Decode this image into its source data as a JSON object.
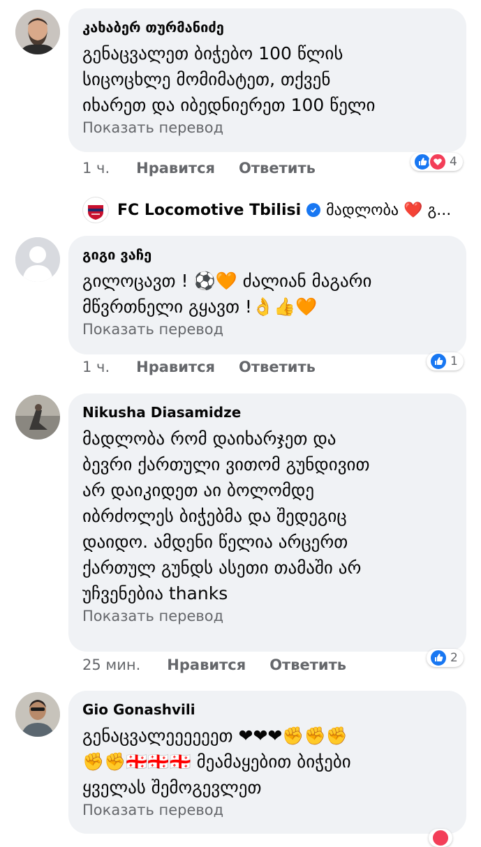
{
  "comments": [
    {
      "author": "კახაბერ თურმანიძე",
      "lines": [
        "გენაცვალეთ ბიჭებო 100 წლის",
        "სიცოცხლე მომიმატეთ, თქვენ",
        "იხარეთ და იბედნიერეთ 100 წელი"
      ],
      "translate": "Показать перевод",
      "time": "1 ч.",
      "like": "Нравится",
      "reply": "Ответить",
      "reaction_count": "4",
      "reactions": [
        "like-icon",
        "love-icon"
      ]
    },
    {
      "author": "გიგი ვაჩე",
      "lines": [
        "გილოცავთ ! ⚽🧡 ძალიან მაგარი",
        "მწვრთნელი გყავთ !👌👍🧡"
      ],
      "translate": "Показать перевод",
      "time": "1 ч.",
      "like": "Нравится",
      "reply": "Ответить",
      "reaction_count": "1",
      "reactions": [
        "like-icon"
      ]
    },
    {
      "author": "Nikusha Diasamidze",
      "lines": [
        "მადლობა რომ დაიხარჯეთ და",
        "ბევრი ქართული ვითომ გუნდივით",
        "არ დაიკიდეთ აი ბოლომდე",
        "იბრძოლეს ბიჭებმა და შედეგიც",
        "დაიდო. ამდენი წელია არცერთ",
        "ქართულ გუნდს ასეთი თამაში არ",
        "უჩვენებია thanks"
      ],
      "translate": "Показать перевод",
      "time": "25 мин.",
      "like": "Нравится",
      "reply": "Ответить",
      "reaction_count": "2",
      "reactions": [
        "like-icon"
      ]
    },
    {
      "author": "Gio Gonashvili",
      "lines": [
        "გენაცვალეეეეეეთ ❤❤❤✊✊✊",
        "✊✊🇬🇪🇬🇪🇬🇪 მეამაყებით ბიჭები",
        "ყველას შემოგევლეთ"
      ],
      "translate": "Показать перевод"
    }
  ],
  "page_reply": {
    "name": "FC Locomotive Tbilisi",
    "text": "მადლობა ❤️ გ..."
  },
  "colors": {
    "bubble": "#f0f2f5",
    "meta_text": "#65676b",
    "like_blue": "#1877f2",
    "love_red": "#f33e58",
    "logo_red": "#c8102e"
  }
}
